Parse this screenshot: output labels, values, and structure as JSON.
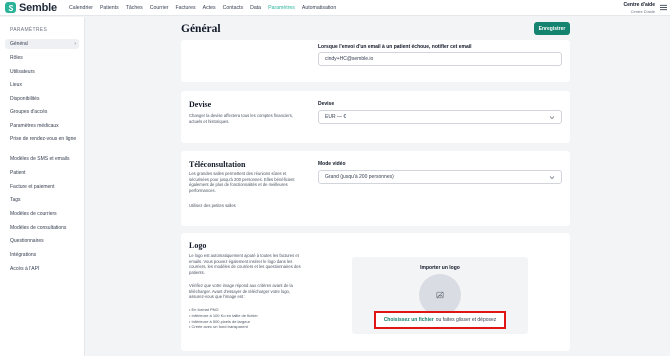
{
  "app": {
    "brand": "Semble"
  },
  "nav": {
    "items": [
      "Calendrier",
      "Patients",
      "Tâches",
      "Courrier",
      "Factures",
      "Actes",
      "Contacts",
      "Data",
      "Paramètres",
      "Automatisation"
    ],
    "active_index": 8
  },
  "help": {
    "title": "Centre d'aide",
    "subtitle": "Centre D'aide"
  },
  "sidebar": {
    "heading": "PARAMÈTRES",
    "items": [
      {
        "label": "Général",
        "active": true
      },
      {
        "label": "Rôles"
      },
      {
        "label": "Utilisateurs"
      },
      {
        "label": "Lieux"
      },
      {
        "label": "Disponibilités"
      },
      {
        "label": "Groupes d'accès"
      },
      {
        "label": "Paramètres médicaux"
      },
      {
        "label": "Prise de rendez-vous en ligne"
      },
      {
        "label": "Modèles de SMS et emails"
      },
      {
        "label": "Patient"
      },
      {
        "label": "Facture et paiement"
      },
      {
        "label": "Tags"
      },
      {
        "label": "Modèles de courriers"
      },
      {
        "label": "Modèles de consultations"
      },
      {
        "label": "Questionnaires"
      },
      {
        "label": "Intégrations"
      },
      {
        "label": "Accès à l'API"
      }
    ]
  },
  "page": {
    "title": "Général",
    "save_label": "Enregistrer"
  },
  "email_section": {
    "label": "Lorsque l'envoi d'un email à un patient échoue, notifier cet email",
    "value": "cindy+HC@semble.io"
  },
  "currency_section": {
    "title": "Devise",
    "description": "Changer la devise affectera tous les comptes financiers, actuels et historiques.",
    "label": "Devise",
    "value": "EUR — €"
  },
  "teleconsult_section": {
    "title": "Téléconsultation",
    "description": "Les grandes salles permettent des réunions sûres et sécurisées pour jusqu'à 200 personnes. Elles bénéficient également de plus de fonctionnalités et de meilleures performances.",
    "small_rooms": "Utilisez des petites salles",
    "label": "Mode vidéo",
    "value": "Grand (jusqu'à 200 personnes)"
  },
  "logo_section": {
    "title": "Logo",
    "description": "Le logo est automatiquement ajouté à toutes les factures et emails. Vous pouvez également insérer le logo dans les courriers, les modèles de courriers et les questionnaires des patients.",
    "requirements_intro": "Vérifiez que votre image répond aux critères avant de la télécharger. Avant d'essayer de télécharger votre logo, assurez-vous que l'image est :",
    "requirements": [
      "En format PNG",
      "Inférieure à 100 Ko en taille de fichier",
      "Inférieure à 500 pixels de largeur",
      "Créée avec un fond transparent"
    ],
    "upload_title": "Importer un logo",
    "upload_link": "Choisissez un fichier",
    "upload_text": "ou faites glisser et déposez"
  },
  "colors": {
    "accent": "#2bb39a",
    "primary_button": "#14836f",
    "highlight_border": "#e01515"
  }
}
